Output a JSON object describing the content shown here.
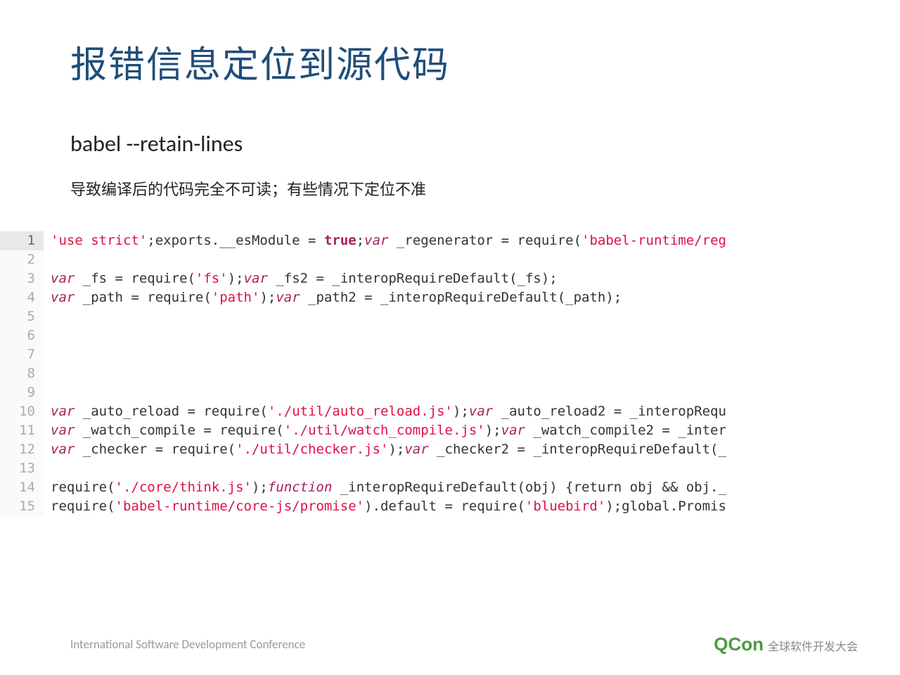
{
  "title": "报错信息定位到源代码",
  "subtitle": "babel --retain-lines",
  "description": "导致编译后的代码完全不可读；有些情况下定位不准",
  "code": {
    "lines": [
      {
        "n": 1,
        "active": true,
        "tokens": [
          {
            "t": "'use strict'",
            "c": "tok-string"
          },
          {
            "t": ";exports.__esModule = "
          },
          {
            "t": "true",
            "c": "tok-bold"
          },
          {
            "t": ";"
          },
          {
            "t": "var",
            "c": "tok-keyword"
          },
          {
            "t": " _regenerator = require("
          },
          {
            "t": "'babel-runtime/reg",
            "c": "tok-string"
          }
        ]
      },
      {
        "n": 2,
        "active": false,
        "tokens": []
      },
      {
        "n": 3,
        "active": false,
        "tokens": [
          {
            "t": "var",
            "c": "tok-keyword"
          },
          {
            "t": " _fs = require("
          },
          {
            "t": "'fs'",
            "c": "tok-string"
          },
          {
            "t": ");"
          },
          {
            "t": "var",
            "c": "tok-keyword"
          },
          {
            "t": " _fs2 = _interopRequireDefault(_fs);"
          }
        ]
      },
      {
        "n": 4,
        "active": false,
        "tokens": [
          {
            "t": "var",
            "c": "tok-keyword"
          },
          {
            "t": " _path = require("
          },
          {
            "t": "'path'",
            "c": "tok-string"
          },
          {
            "t": ");"
          },
          {
            "t": "var",
            "c": "tok-keyword"
          },
          {
            "t": " _path2 = _interopRequireDefault(_path);"
          }
        ]
      },
      {
        "n": 5,
        "active": false,
        "tokens": []
      },
      {
        "n": 6,
        "active": false,
        "tokens": []
      },
      {
        "n": 7,
        "active": false,
        "tokens": []
      },
      {
        "n": 8,
        "active": false,
        "tokens": []
      },
      {
        "n": 9,
        "active": false,
        "tokens": []
      },
      {
        "n": 10,
        "active": false,
        "tokens": [
          {
            "t": "var",
            "c": "tok-keyword"
          },
          {
            "t": " _auto_reload = require("
          },
          {
            "t": "'./util/auto_reload.js'",
            "c": "tok-string"
          },
          {
            "t": ");"
          },
          {
            "t": "var",
            "c": "tok-keyword"
          },
          {
            "t": " _auto_reload2 = _interopRequ"
          }
        ]
      },
      {
        "n": 11,
        "active": false,
        "tokens": [
          {
            "t": "var",
            "c": "tok-keyword"
          },
          {
            "t": " _watch_compile = require("
          },
          {
            "t": "'./util/watch_compile.js'",
            "c": "tok-string"
          },
          {
            "t": ");"
          },
          {
            "t": "var",
            "c": "tok-keyword"
          },
          {
            "t": " _watch_compile2 = _inter"
          }
        ]
      },
      {
        "n": 12,
        "active": false,
        "tokens": [
          {
            "t": "var",
            "c": "tok-keyword"
          },
          {
            "t": " _checker = require("
          },
          {
            "t": "'./util/checker.js'",
            "c": "tok-string"
          },
          {
            "t": ");"
          },
          {
            "t": "var",
            "c": "tok-keyword"
          },
          {
            "t": " _checker2 = _interopRequireDefault(_"
          }
        ]
      },
      {
        "n": 13,
        "active": false,
        "tokens": []
      },
      {
        "n": 14,
        "active": false,
        "tokens": [
          {
            "t": "require("
          },
          {
            "t": "'./core/think.js'",
            "c": "tok-string"
          },
          {
            "t": ");"
          },
          {
            "t": "function",
            "c": "tok-func"
          },
          {
            "t": " _interopRequireDefault(obj) {return obj && obj._"
          }
        ]
      },
      {
        "n": 15,
        "active": false,
        "tokens": [
          {
            "t": "require("
          },
          {
            "t": "'babel-runtime/core-js/promise'",
            "c": "tok-string"
          },
          {
            "t": ").default = require("
          },
          {
            "t": "'bluebird'",
            "c": "tok-string"
          },
          {
            "t": ");global.Promis"
          }
        ]
      }
    ]
  },
  "footer": {
    "left": "International Software Development Conference",
    "logo": "QCon",
    "tag": "全球软件开发大会"
  }
}
